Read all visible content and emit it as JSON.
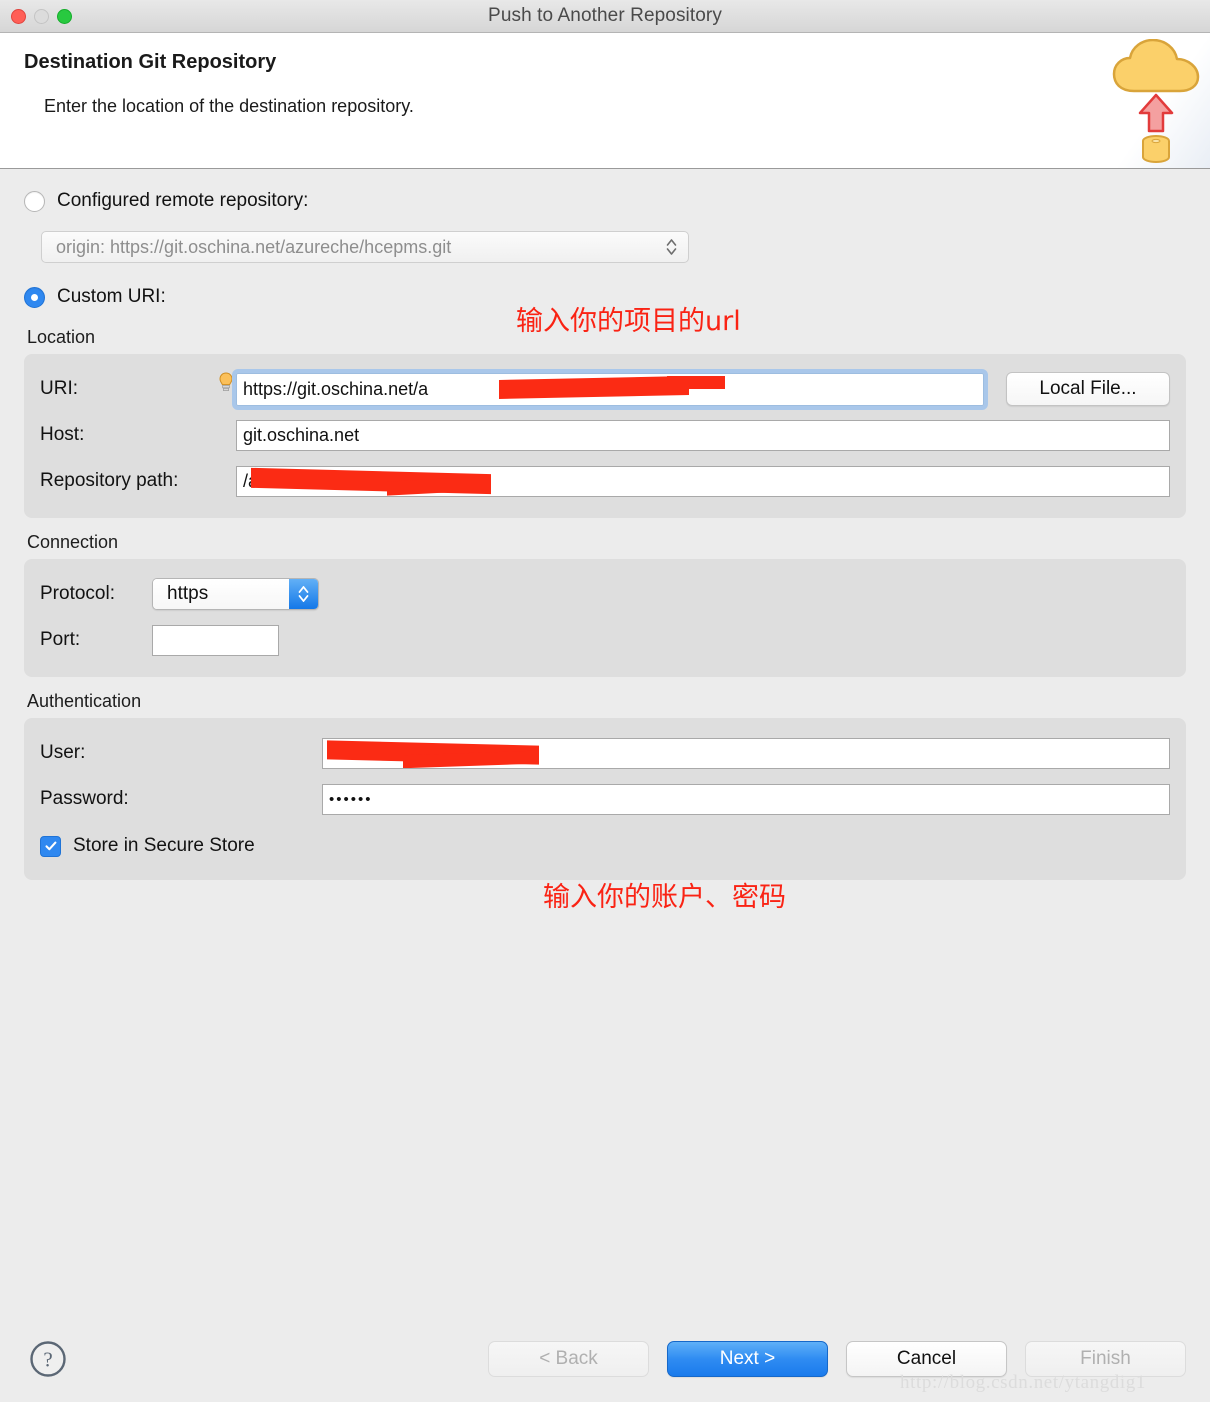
{
  "window": {
    "title": "Push to Another Repository",
    "traffic_lights": [
      "close-button",
      "minimize-button",
      "maximize-button"
    ]
  },
  "header": {
    "title": "Destination Git Repository",
    "subtitle": "Enter the location of the destination repository.",
    "banner_icon": "cloud-push-icon"
  },
  "source": {
    "configured_label": "Configured remote repository:",
    "configured_selected": false,
    "remote_value": "origin: https://git.oschina.net/azureche/hcepms.git",
    "custom_label": "Custom URI:",
    "custom_selected": true
  },
  "annotations": {
    "url_hint": "输入你的项目的url",
    "credentials_hint": "输入你的账户、密码"
  },
  "location": {
    "group_title": "Location",
    "uri_label": "URI:",
    "uri_value": "https://git.oschina.net/a",
    "host_label": "Host:",
    "host_value": "git.oschina.net",
    "repo_label": "Repository path:",
    "repo_value": "/a",
    "local_file_button": "Local File..."
  },
  "connection": {
    "group_title": "Connection",
    "protocol_label": "Protocol:",
    "protocol_value": "https",
    "port_label": "Port:",
    "port_value": ""
  },
  "authentication": {
    "group_title": "Authentication",
    "user_label": "User:",
    "user_value": "",
    "password_label": "Password:",
    "password_value": "••••••",
    "store_label": "Store in Secure Store",
    "store_checked": true
  },
  "footer": {
    "help_icon": "help-icon",
    "back_label": "< Back",
    "next_label": "Next >",
    "cancel_label": "Cancel",
    "finish_label": "Finish",
    "watermark": "http://blog.csdn.net/ytangdig1"
  },
  "colors": {
    "accent": "#2f88f0",
    "primary_button": "#1a7bec",
    "annotation": "#fa2314",
    "redaction": "#fb2b14",
    "panel": "#dedede",
    "page": "#ececec"
  }
}
